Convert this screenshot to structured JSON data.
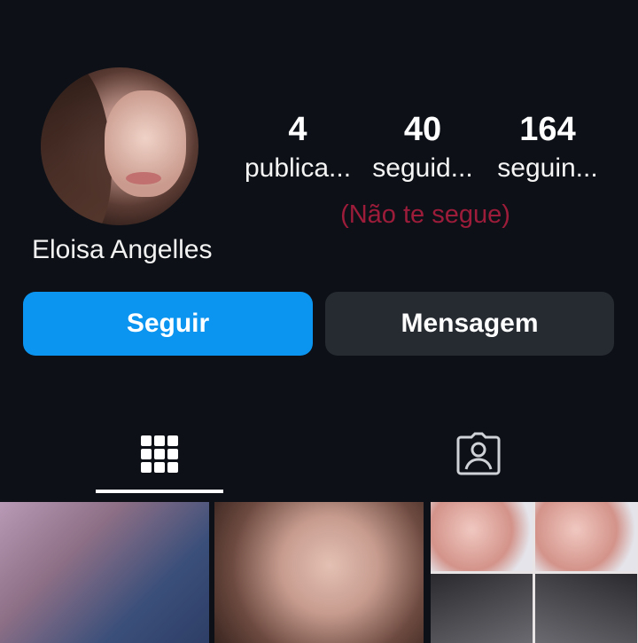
{
  "profile": {
    "name": "Eloisa Angelles",
    "stats": [
      {
        "value": "4",
        "label": "publica..."
      },
      {
        "value": "40",
        "label": "seguid..."
      },
      {
        "value": "164",
        "label": "seguin..."
      }
    ],
    "not_following_note": "(Não te segue)"
  },
  "actions": {
    "follow_label": "Seguir",
    "message_label": "Mensagem"
  },
  "tabs": {
    "grid_icon": "grid-icon",
    "tagged_icon": "tagged-person-icon",
    "active": "grid"
  },
  "colors": {
    "background": "#0d1117",
    "follow_button": "#0c95f0",
    "message_button": "#262a31",
    "not_following_text": "#9c1c3a"
  }
}
